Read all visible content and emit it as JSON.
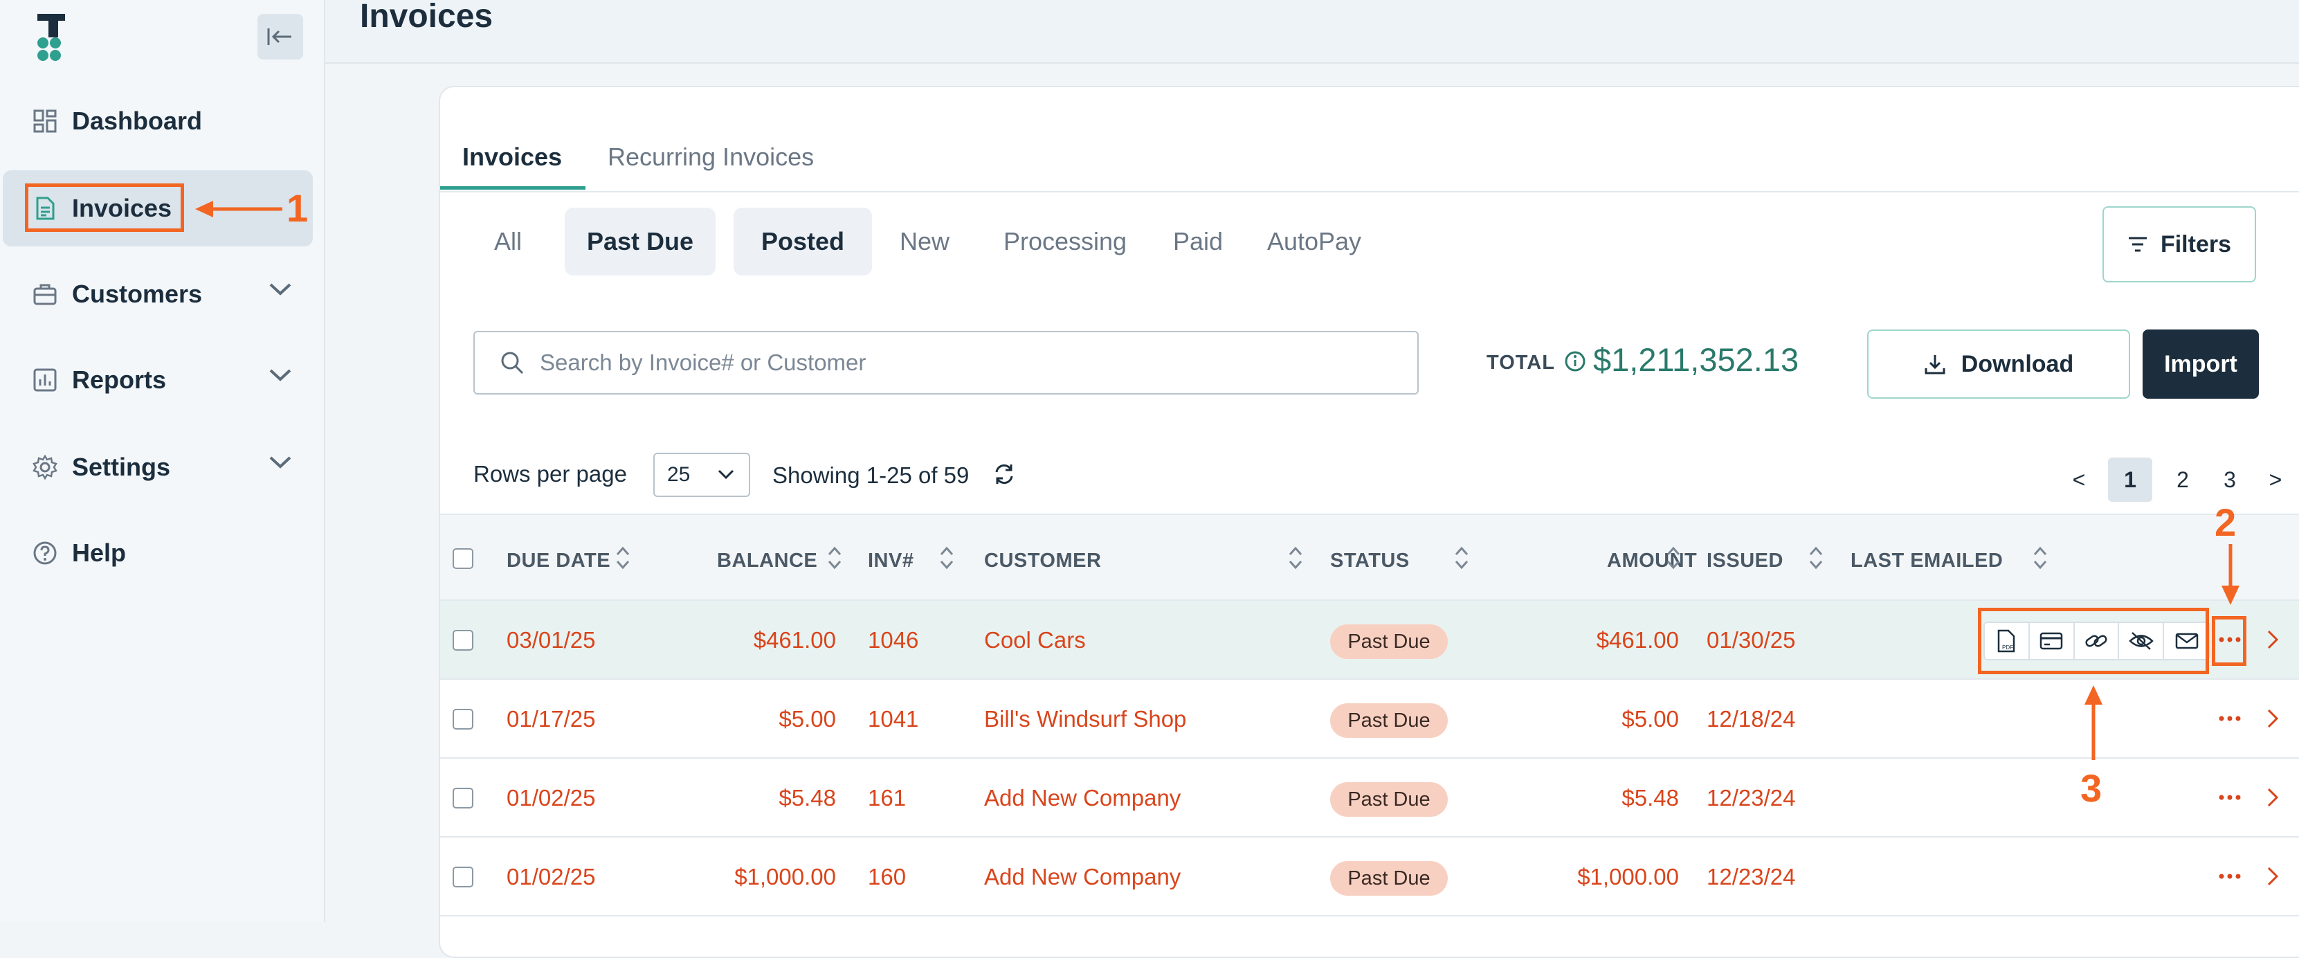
{
  "sidebar": {
    "items": [
      {
        "label": "Dashboard",
        "icon": "dashboard-icon"
      },
      {
        "label": "Invoices",
        "icon": "document-icon",
        "active": true
      },
      {
        "label": "Customers",
        "icon": "briefcase-icon",
        "expandable": true
      },
      {
        "label": "Reports",
        "icon": "chart-icon",
        "expandable": true
      },
      {
        "label": "Settings",
        "icon": "gear-icon",
        "expandable": true
      },
      {
        "label": "Help",
        "icon": "question-icon"
      }
    ]
  },
  "header": {
    "title": "Invoices"
  },
  "tabs": [
    {
      "label": "Invoices",
      "active": true
    },
    {
      "label": "Recurring Invoices",
      "active": false
    }
  ],
  "filters": {
    "chips": [
      {
        "label": "All",
        "selected": false
      },
      {
        "label": "Past Due",
        "selected": true
      },
      {
        "label": "Posted",
        "selected": true
      },
      {
        "label": "New",
        "selected": false
      },
      {
        "label": "Processing",
        "selected": false
      },
      {
        "label": "Paid",
        "selected": false
      },
      {
        "label": "AutoPay",
        "selected": false
      }
    ],
    "button_label": "Filters"
  },
  "search": {
    "placeholder": "Search by Invoice# or Customer",
    "value": ""
  },
  "total": {
    "label": "TOTAL",
    "value": "$1,211,352.13"
  },
  "actions": {
    "download_label": "Download",
    "import_label": "Import"
  },
  "pagination": {
    "rows_label": "Rows per page",
    "rows_value": "25",
    "showing": "Showing 1-25 of 59",
    "prev": "<",
    "next": ">",
    "pages": [
      "1",
      "2",
      "3"
    ],
    "current_page": "1"
  },
  "table": {
    "columns": [
      "DUE DATE",
      "BALANCE",
      "INV#",
      "CUSTOMER",
      "STATUS",
      "AMOUNT",
      "ISSUED",
      "LAST EMAILED"
    ],
    "rows": [
      {
        "due": "03/01/25",
        "balance": "$461.00",
        "inv": "1046",
        "customer": "Cool Cars",
        "status": "Past Due",
        "amount": "$461.00",
        "issued": "01/30/25"
      },
      {
        "due": "01/17/25",
        "balance": "$5.00",
        "inv": "1041",
        "customer": "Bill's Windsurf Shop",
        "status": "Past Due",
        "amount": "$5.00",
        "issued": "12/18/24"
      },
      {
        "due": "01/02/25",
        "balance": "$5.48",
        "inv": "161",
        "customer": "Add New Company",
        "status": "Past Due",
        "amount": "$5.48",
        "issued": "12/23/24"
      },
      {
        "due": "01/02/25",
        "balance": "$1,000.00",
        "inv": "160",
        "customer": "Add New Company",
        "status": "Past Due",
        "amount": "$1,000.00",
        "issued": "12/23/24"
      }
    ],
    "row_action_icons": [
      "pdf-icon",
      "credit-card-icon",
      "link-icon",
      "eye-off-icon",
      "mail-icon"
    ]
  },
  "annotations": {
    "n1": "1",
    "n2": "2",
    "n3": "3"
  },
  "colors": {
    "accent": "#2f9f8f",
    "brand_dark": "#1c2e3d",
    "past_due_text": "#d9451c",
    "badge_bg": "#f8d0c2",
    "annotation": "#f26522"
  }
}
